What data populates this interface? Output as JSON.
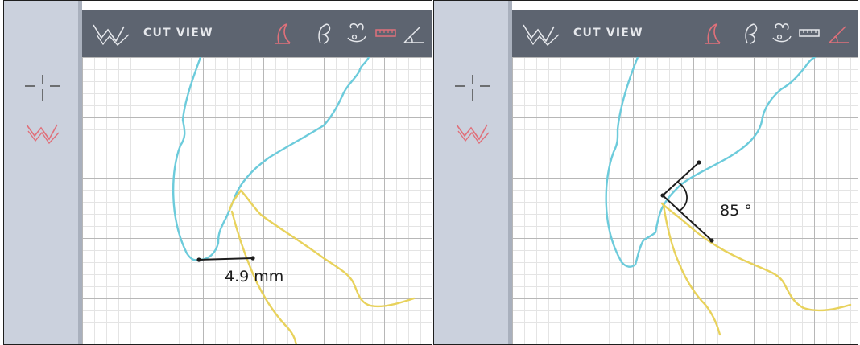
{
  "panels": [
    {
      "header": {
        "title": "CUT VIEW"
      },
      "tools": [
        "cut-tool",
        "segment-tool",
        "tooth-tool",
        "ruler-tool",
        "angle-tool"
      ],
      "active_tool": "cut-tool",
      "measurement": {
        "type": "distance",
        "label": "4.9 mm"
      }
    },
    {
      "header": {
        "title": "CUT VIEW"
      },
      "tools": [
        "cut-tool",
        "segment-tool",
        "tooth-tool",
        "ruler-tool",
        "angle-tool"
      ],
      "active_tool": "angle-tool",
      "measurement": {
        "type": "angle",
        "label": "85 °"
      }
    }
  ],
  "colors": {
    "header_bg": "#5d6470",
    "rail_bg": "#cbd1dd",
    "accent": "#e0707a",
    "soft_tissue_line": "#6ccbdb",
    "bone_line": "#e8d25c",
    "measure_line": "#1c1c1c"
  }
}
